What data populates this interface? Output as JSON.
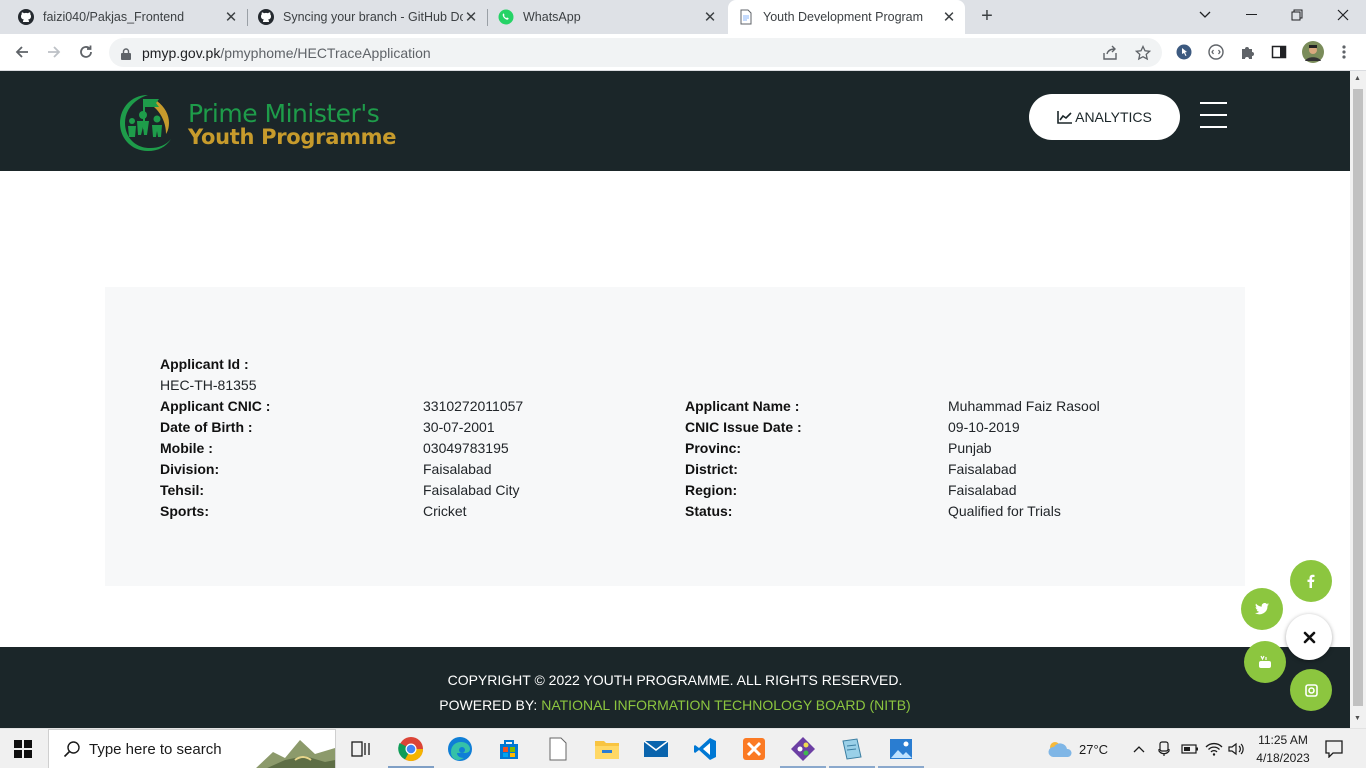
{
  "browser": {
    "tabs": [
      {
        "title": "faizi040/Pakjas_Frontend",
        "icon": "github-icon",
        "active": false
      },
      {
        "title": "Syncing your branch - GitHub Do",
        "icon": "github-icon",
        "active": false
      },
      {
        "title": "WhatsApp",
        "icon": "whatsapp-icon",
        "active": false
      },
      {
        "title": "Youth Development Program",
        "icon": "document-icon",
        "active": true
      }
    ],
    "url_host": "pmyp.gov.pk",
    "url_path": "/pmyphome/HECTraceApplication"
  },
  "site": {
    "logo_line1": "Prime Minister's",
    "logo_line2": "Youth Programme",
    "analytics_label": "ANALYTICS"
  },
  "applicant": {
    "id_label": "Applicant Id :",
    "id_value": "HEC-TH-81355",
    "rows": [
      {
        "label1": "Applicant CNIC :",
        "value1": "3310272011057",
        "label2": "Applicant Name :",
        "value2": "Muhammad Faiz Rasool"
      },
      {
        "label1": "Date of Birth :",
        "value1": "30-07-2001",
        "label2": "CNIC Issue Date :",
        "value2": "09-10-2019"
      },
      {
        "label1": "Mobile :",
        "value1": "03049783195",
        "label2": "Provinc:",
        "value2": "Punjab"
      },
      {
        "label1": "Division:",
        "value1": "Faisalabad",
        "label2": "District:",
        "value2": "Faisalabad"
      },
      {
        "label1": "Tehsil:",
        "value1": "Faisalabad City",
        "label2": "Region:",
        "value2": "Faisalabad"
      },
      {
        "label1": "Sports:",
        "value1": "Cricket",
        "label2": "Status:",
        "value2": "Qualified for Trials"
      }
    ]
  },
  "footer": {
    "copyright": "COPYRIGHT © 2022 YOUTH PROGRAMME. ALL RIGHTS RESERVED.",
    "powered_by": "POWERED BY:",
    "nitb": "NATIONAL INFORMATION TECHNOLOGY BOARD (NITB)"
  },
  "social": [
    {
      "name": "facebook",
      "glyph": "f"
    },
    {
      "name": "twitter",
      "glyph": "t"
    },
    {
      "name": "close",
      "glyph": "✖"
    },
    {
      "name": "youtube",
      "glyph": "You"
    },
    {
      "name": "instagram",
      "glyph": "◎"
    }
  ],
  "taskbar": {
    "search_placeholder": "Type here to search",
    "weather": "27°C",
    "time": "11:25 AM",
    "date": "4/18/2023"
  },
  "colors": {
    "header_bg": "#1b2629",
    "brand_green": "#1e9c4a",
    "brand_gold": "#c79b2c",
    "social_green": "#8cc63f",
    "panel_bg": "#f7f8f9"
  }
}
